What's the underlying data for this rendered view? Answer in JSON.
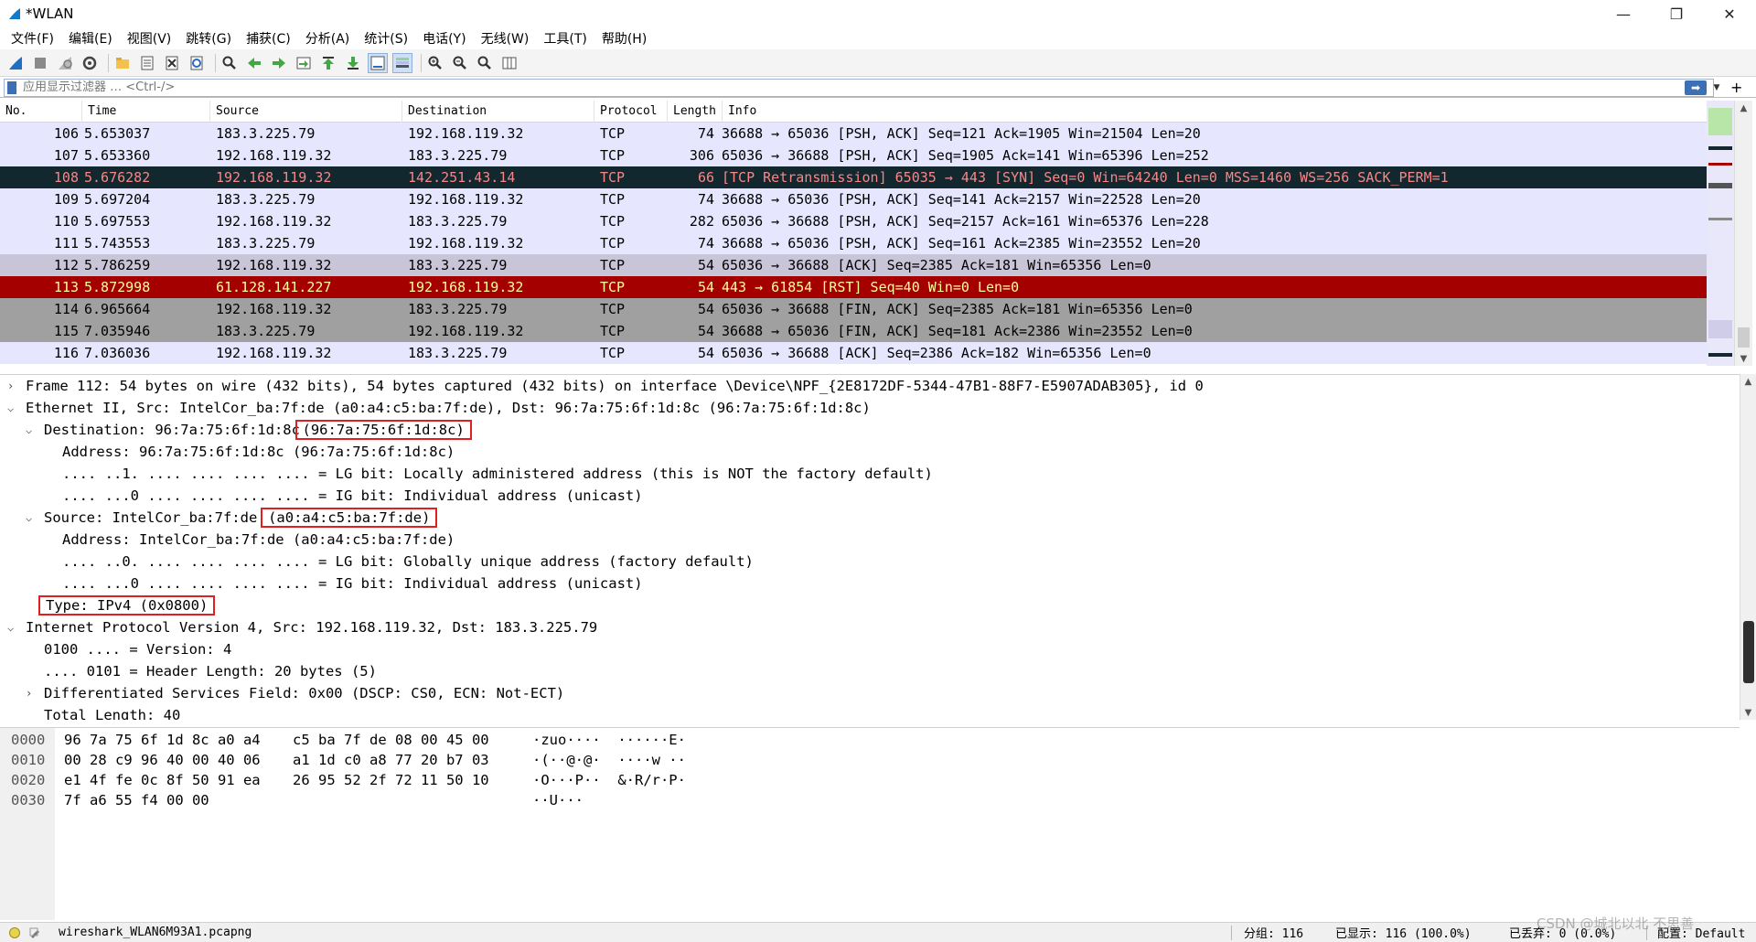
{
  "window": {
    "title": "*WLAN",
    "minimize": "—",
    "maximize": "❐",
    "close": "✕"
  },
  "menu": [
    "文件(F)",
    "编辑(E)",
    "视图(V)",
    "跳转(G)",
    "捕获(C)",
    "分析(A)",
    "统计(S)",
    "电话(Y)",
    "无线(W)",
    "工具(T)",
    "帮助(H)"
  ],
  "filter": {
    "placeholder": "应用显示过滤器 … <Ctrl-/>",
    "apply": "➡",
    "plus": "+"
  },
  "columns": [
    "No.",
    "Time",
    "Source",
    "Destination",
    "Protocol",
    "Length",
    "Info"
  ],
  "packets": [
    {
      "no": "106",
      "time": "5.653037",
      "src": "183.3.225.79",
      "dst": "192.168.119.32",
      "proto": "TCP",
      "len": "74",
      "info": "36688 → 65036 [PSH, ACK] Seq=121 Ack=1905 Win=21504 Len=20",
      "style": "tcp"
    },
    {
      "no": "107",
      "time": "5.653360",
      "src": "192.168.119.32",
      "dst": "183.3.225.79",
      "proto": "TCP",
      "len": "306",
      "info": "65036 → 36688 [PSH, ACK] Seq=1905 Ack=141 Win=65396 Len=252",
      "style": "tcp"
    },
    {
      "no": "108",
      "time": "5.676282",
      "src": "192.168.119.32",
      "dst": "142.251.43.14",
      "proto": "TCP",
      "len": "66",
      "info": "[TCP Retransmission] 65035 → 443 [SYN] Seq=0 Win=64240 Len=0 MSS=1460 WS=256 SACK_PERM=1",
      "style": "sel"
    },
    {
      "no": "109",
      "time": "5.697204",
      "src": "183.3.225.79",
      "dst": "192.168.119.32",
      "proto": "TCP",
      "len": "74",
      "info": "36688 → 65036 [PSH, ACK] Seq=141 Ack=2157 Win=22528 Len=20",
      "style": "tcp"
    },
    {
      "no": "110",
      "time": "5.697553",
      "src": "192.168.119.32",
      "dst": "183.3.225.79",
      "proto": "TCP",
      "len": "282",
      "info": "65036 → 36688 [PSH, ACK] Seq=2157 Ack=161 Win=65376 Len=228",
      "style": "tcp"
    },
    {
      "no": "111",
      "time": "5.743553",
      "src": "183.3.225.79",
      "dst": "192.168.119.32",
      "proto": "TCP",
      "len": "74",
      "info": "36688 → 65036 [PSH, ACK] Seq=161 Ack=2385 Win=23552 Len=20",
      "style": "tcp"
    },
    {
      "no": "112",
      "time": "5.786259",
      "src": "192.168.119.32",
      "dst": "183.3.225.79",
      "proto": "TCP",
      "len": "54",
      "info": "65036 → 36688 [ACK] Seq=2385 Ack=181 Win=65356 Len=0",
      "style": "ack"
    },
    {
      "no": "113",
      "time": "5.872998",
      "src": "61.128.141.227",
      "dst": "192.168.119.32",
      "proto": "TCP",
      "len": "54",
      "info": "443 → 61854 [RST] Seq=40 Win=0 Len=0",
      "style": "rst"
    },
    {
      "no": "114",
      "time": "6.965664",
      "src": "192.168.119.32",
      "dst": "183.3.225.79",
      "proto": "TCP",
      "len": "54",
      "info": "65036 → 36688 [FIN, ACK] Seq=2385 Ack=181 Win=65356 Len=0",
      "style": "fin"
    },
    {
      "no": "115",
      "time": "7.035946",
      "src": "183.3.225.79",
      "dst": "192.168.119.32",
      "proto": "TCP",
      "len": "54",
      "info": "36688 → 65036 [FIN, ACK] Seq=181 Ack=2386 Win=23552 Len=0",
      "style": "fin"
    },
    {
      "no": "116",
      "time": "7.036036",
      "src": "192.168.119.32",
      "dst": "183.3.225.79",
      "proto": "TCP",
      "len": "54",
      "info": "65036 → 36688 [ACK] Seq=2386 Ack=182 Win=65356 Len=0",
      "style": "tcp"
    }
  ],
  "details": [
    {
      "arrow": ">",
      "indent": 0,
      "text": "Frame 112: 54 bytes on wire (432 bits), 54 bytes captured (432 bits) on interface \\Device\\NPF_{2E8172DF-5344-47B1-88F7-E5907ADAB305}, id 0"
    },
    {
      "arrow": "v",
      "indent": 0,
      "text": "Ethernet II, Src: IntelCor_ba:7f:de (a0:a4:c5:ba:7f:de), Dst: 96:7a:75:6f:1d:8c (96:7a:75:6f:1d:8c)"
    },
    {
      "arrow": "v",
      "indent": 1,
      "text": "Destination: 96:7a:75:6f:1d:8c",
      "hl": "(96:7a:75:6f:1d:8c)"
    },
    {
      "arrow": "",
      "indent": 2,
      "text": "Address: 96:7a:75:6f:1d:8c (96:7a:75:6f:1d:8c)"
    },
    {
      "arrow": "",
      "indent": 2,
      "text": ".... ..1. .... .... .... .... = LG bit: Locally administered address (this is NOT the factory default)"
    },
    {
      "arrow": "",
      "indent": 2,
      "text": ".... ...0 .... .... .... .... = IG bit: Individual address (unicast)"
    },
    {
      "arrow": "v",
      "indent": 1,
      "text": "Source: IntelCor_ba:7f:de ",
      "hl": "(a0:a4:c5:ba:7f:de)"
    },
    {
      "arrow": "",
      "indent": 2,
      "text": "Address: IntelCor_ba:7f:de (a0:a4:c5:ba:7f:de)"
    },
    {
      "arrow": "",
      "indent": 2,
      "text": ".... ..0. .... .... .... .... = LG bit: Globally unique address (factory default)"
    },
    {
      "arrow": "",
      "indent": 2,
      "text": ".... ...0 .... .... .... .... = IG bit: Individual address (unicast)"
    },
    {
      "arrow": "",
      "indent": 1,
      "text": "",
      "hl": "Type: IPv4 (0x0800)"
    },
    {
      "arrow": "v",
      "indent": 0,
      "text": "Internet Protocol Version 4, Src: 192.168.119.32, Dst: 183.3.225.79"
    },
    {
      "arrow": "",
      "indent": 1,
      "text": "0100 .... = Version: 4"
    },
    {
      "arrow": "",
      "indent": 1,
      "text": ".... 0101 = Header Length: 20 bytes (5)"
    },
    {
      "arrow": ">",
      "indent": 1,
      "text": "Differentiated Services Field: 0x00 (DSCP: CS0, ECN: Not-ECT)"
    },
    {
      "arrow": "",
      "indent": 1,
      "text": "Total Length: 40"
    }
  ],
  "bytes": [
    {
      "off": "0000",
      "hex1": "96 7a 75 6f 1d 8c a0 a4",
      "hex2": "c5 ba 7f de 08 00 45 00",
      "ascii": "·zuo····  ······E·"
    },
    {
      "off": "0010",
      "hex1": "00 28 c9 96 40 00 40 06",
      "hex2": "a1 1d c0 a8 77 20 b7 03",
      "ascii": "·(··@·@·  ····w ··"
    },
    {
      "off": "0020",
      "hex1": "e1 4f fe 0c 8f 50 91 ea",
      "hex2": "26 95 52 2f 72 11 50 10",
      "ascii": "·O···P··  &·R/r·P·"
    },
    {
      "off": "0030",
      "hex1": "7f a6 55 f4 00 00",
      "hex2": "",
      "ascii": "··U···"
    }
  ],
  "status": {
    "file": "wireshark_WLAN6M93A1.pcapng",
    "packets": "分组: 116",
    "displayed": "已显示: 116 (100.0%)",
    "dropped": "已丢弃: 0 (0.0%)",
    "profile": "配置: Default",
    "watermark": "CSDN @城北以北 不思善"
  }
}
